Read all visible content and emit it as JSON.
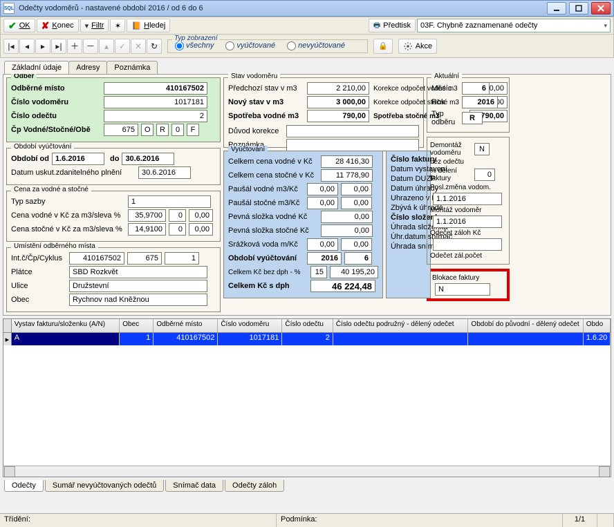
{
  "window": {
    "title": "Odečty vodoměrů - nastavené období 2016 / od 6 do 6"
  },
  "toolbar1": {
    "ok": "OK",
    "konec": "Konec",
    "filtr": "Filtr",
    "hledej": "Hledej",
    "predtisk": "Předtisk",
    "doc_select": "03F. Chybně zaznamenané odečty"
  },
  "toolbar2": {
    "typ_zobrazeni": "Typ zobrazení",
    "vsechny": "všechny",
    "vyuctovane": "vyúčtované",
    "nevyuctovane": "nevyúčtované",
    "akce": "Akce"
  },
  "tabs": {
    "zakladni": "Základní údaje",
    "adresy": "Adresy",
    "poznamka": "Poznámka"
  },
  "odber": {
    "legend": "Odběr",
    "odberne_misto_lbl": "Odběrné místo",
    "odberne_misto_val": "410167502",
    "cislo_vodomeru_lbl": "Číslo vodoměru",
    "cislo_vodomeru_val": "1017181",
    "cislo_odectu_lbl": "Číslo odečtu",
    "cislo_odectu_val": "2",
    "cp_lbl": "Čp  Vodné/Stočné/Obě",
    "cp_val": "675",
    "flag1": "O",
    "flag2": "R",
    "flag3": "0",
    "flag4": "F"
  },
  "obdobi": {
    "legend": "Období vyúčtování",
    "od_lbl": "Období od",
    "od_val": "1.6.2016",
    "do_lbl": "do",
    "do_val": "30.6.2016",
    "dusk_lbl": "Datum uskut.zdanitelného plnění",
    "dusk_val": "30.6.2016"
  },
  "cena": {
    "legend": "Cena za vodné a stočné",
    "typ_lbl": "Typ sazby",
    "typ_val": "1",
    "vodne_lbl": "Cena vodné v Kč za m3/sleva %",
    "vodne_val": "35,9700",
    "vodne_s1": "0",
    "vodne_s2": "0,00",
    "stocne_lbl": "Cena stočné v Kč za m3/sleva %",
    "stocne_val": "14,9100",
    "stocne_s1": "0",
    "stocne_s2": "0,00"
  },
  "umisteni": {
    "legend": "Umístění odběrného místa",
    "int_lbl": "Int.č/Čp/Cyklus",
    "int_v1": "410167502",
    "int_v2": "675",
    "int_v3": "1",
    "platce_lbl": "Plátce",
    "platce_val": "SBD Rozkvět",
    "ulice_lbl": "Ulice",
    "ulice_val": "Družstevní",
    "obec_lbl": "Obec",
    "obec_val": "Rychnov nad Kněžnou"
  },
  "stav": {
    "legend": "Stav vodoměru",
    "predchozi_lbl": "Předchozí stav v m3",
    "predchozi_val": "2 210,00",
    "novy_lbl": "Nový stav v m3",
    "novy_val": "3 000,00",
    "spotreba_v_lbl": "Spotřeba vodné m3",
    "spotreba_v_val": "790,00",
    "kor_v_lbl": "Korekce odpočet vodné m3",
    "kor_v_val": "0,00",
    "kor_s_lbl": "Korekce odpočet stočné m3",
    "kor_s_val": "0,00",
    "spotreba_s_lbl": "Spotřeba stočné m3",
    "spotreba_s_val": "790,00",
    "duvod_lbl": "Důvod korekce",
    "poznamka_lbl": "Poznámka"
  },
  "vyuct": {
    "legend": "Vyúčtování",
    "cena_vodne_lbl": "Celkem cena vodné v Kč",
    "cena_vodne_val": "28 416,30",
    "cena_stocne_lbl": "Celkem cena stočné v Kč",
    "cena_stocne_val": "11 778,90",
    "pausal_v_lbl": "Paušál vodné m3/Kč",
    "pausal_v_v1": "0,00",
    "pausal_v_v2": "0,00",
    "pausal_s_lbl": "Paušál stočné m3/Kč",
    "pausal_s_v1": "0,00",
    "pausal_s_v2": "0,00",
    "pevna_v_lbl": "Pevná složka vodné Kč",
    "pevna_v_val": "0,00",
    "pevna_s_lbl": "Pevná složka stočné Kč",
    "pevna_s_val": "0,00",
    "srazk_lbl": "Srážková voda m/Kč",
    "srazk_v1": "0,00",
    "srazk_v2": "0,00",
    "obd_vy_lbl": "Období vyúčtování",
    "obd_vy_v1": "2016",
    "obd_vy_v2": "6",
    "bezdph_lbl": "Celkem Kč bez dph  - %",
    "bezdph_pct": "15",
    "bezdph_val": "40 195,20",
    "sdph_lbl": "Celkem Kč s dph",
    "sdph_val": "46 224,48"
  },
  "faktura": {
    "cislo_lbl": "Číslo faktury",
    "datum_vyst_lbl": "Datum vystavení",
    "datum_duzp_lbl": "Datum DUZP",
    "datum_uhr_lbl": "Datum úhrady",
    "uhrazeno_lbl": "Uhrazeno v Kč",
    "zbyva_lbl": "Zbývá k úhradě",
    "slozenka_lbl": "Číslo složenky",
    "uhr_sloz_lbl": "Úhrada složenka",
    "uhr_datum_sn_lbl": "Úhr.datum snímač",
    "uhr_snimac_lbl": "Úhrada snímač Kč"
  },
  "aktualni": {
    "legend": "Aktuální",
    "mesic_lbl": "Měsíc",
    "mesic_val": "6",
    "rok_lbl": "Rok",
    "rok_val": "2016",
    "typ_lbl": "Typ odběru",
    "typ_val": "R"
  },
  "side": {
    "demo_lbl": "Demontáž vodoměru",
    "demo_val": "N",
    "bez_lbl": "bez odečtu",
    "deleni_lbl": "% dělení faktury",
    "deleni_val": "0",
    "posl_lbl": "Posl.změna vodom.",
    "posl_val": "1.1.2016",
    "mont_lbl": "Montáž vodoměr",
    "mont_val": "1.1.2016",
    "odecet_zal_lbl": "Odečet záloh Kč",
    "odecet_pocet_lbl": "Odečet zál.počet",
    "blokace_lbl": "Blokace faktury",
    "blokace_val": "N"
  },
  "grid": {
    "headers": [
      "",
      "Vystav fakturu/složenku (A/N)",
      "Obec",
      "Odběrné místo",
      "Číslo vodoměru",
      "Číslo odečtu",
      "Číslo odečtu podružný - dělený odečet",
      "Období do původní - dělený odečet",
      "Obdo"
    ],
    "row": {
      "vystav": "A",
      "obec": "1",
      "misto": "410167502",
      "vodomer": "1017181",
      "odecet": "2",
      "last": "1.6.20"
    }
  },
  "btabs": {
    "odecty": "Odečty",
    "sumar": "Sumář nevyúčtovaných odečtů",
    "snimac": "Snímač data",
    "zaloh": "Odečty záloh"
  },
  "status": {
    "trideni_lbl": "Třídění:",
    "podm_lbl": "Podmínka:",
    "count": "1/1"
  }
}
